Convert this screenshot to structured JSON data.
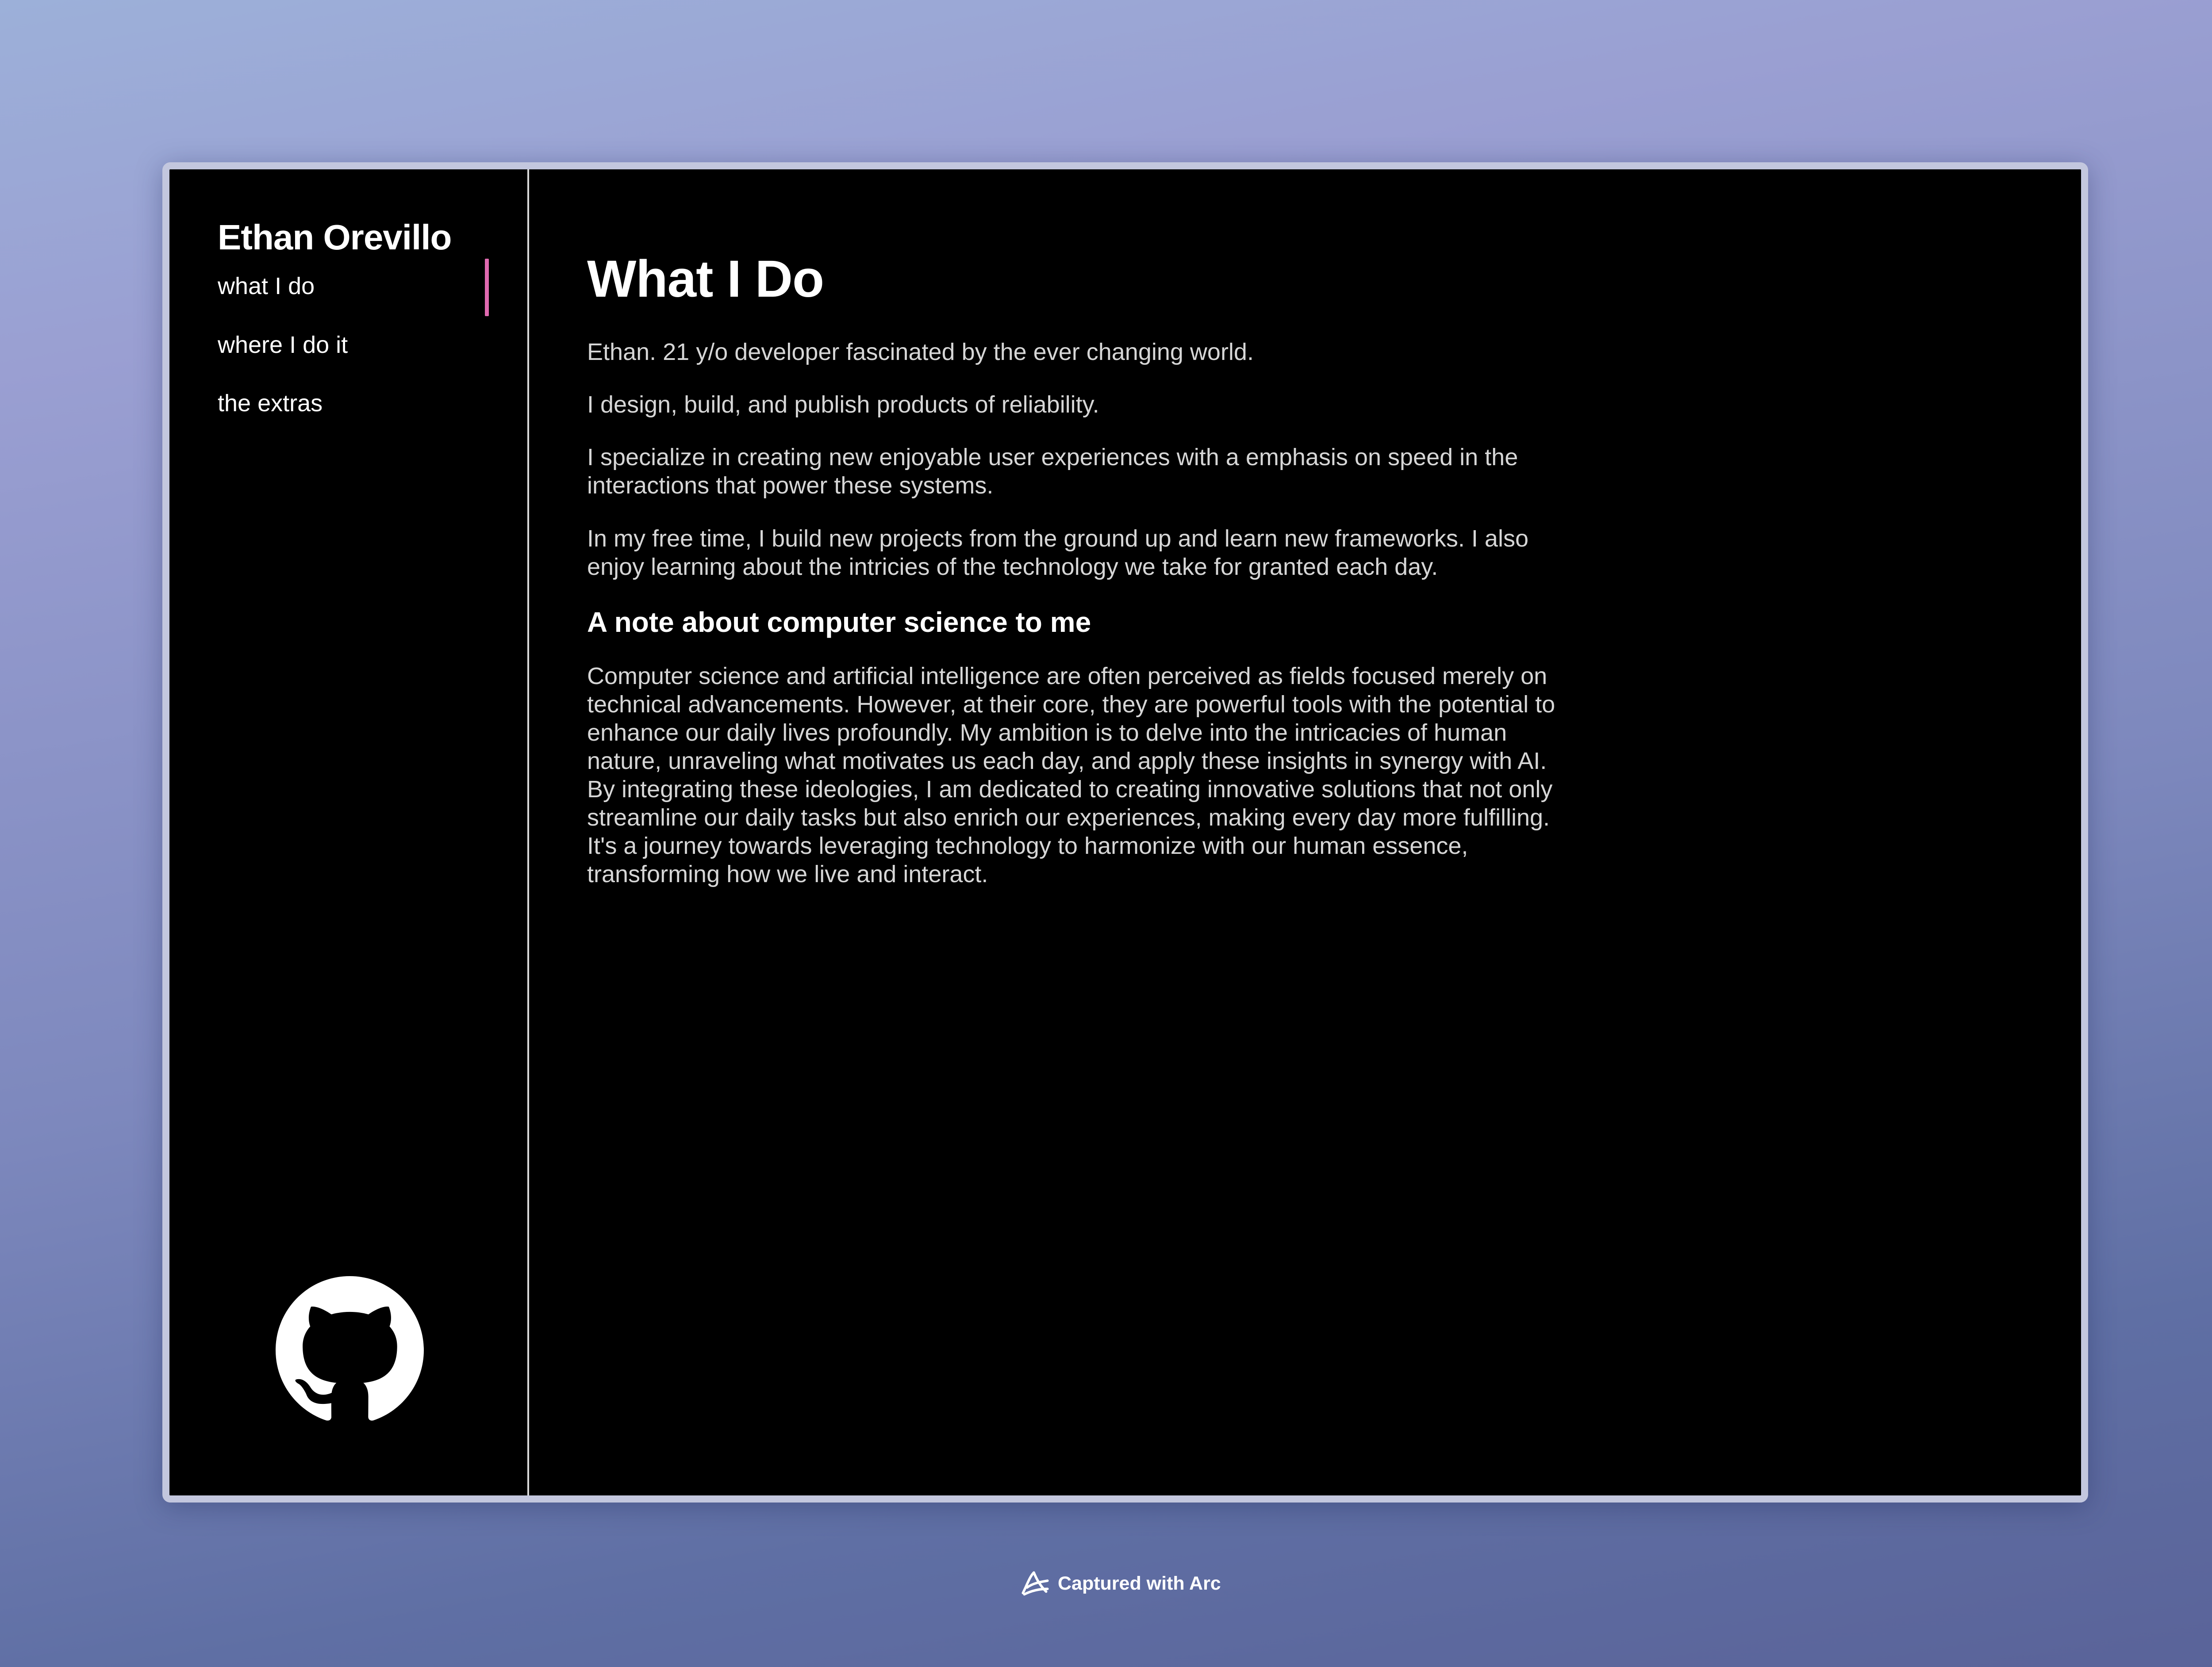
{
  "sidebar": {
    "name": "Ethan Orevillo",
    "nav": [
      {
        "label": "what I do",
        "active": true
      },
      {
        "label": "where I do it",
        "active": false
      },
      {
        "label": "the extras",
        "active": false
      }
    ],
    "social_icon": "github-icon"
  },
  "main": {
    "title": "What I Do",
    "paragraphs": [
      "Ethan. 21 y/o developer fascinated by the ever changing world.",
      "I design, build, and publish products of reliability.",
      "I specialize in creating new enjoyable user experiences with a emphasis on speed in the interactions that power these systems.",
      "In my free time, I build new projects from the ground up and learn new frameworks. I also enjoy learning about the intricies of the technology we take for granted each day."
    ],
    "subheading": "A note about computer science to me",
    "note": "Computer science and artificial intelligence are often perceived as fields focused merely on technical advancements. However, at their core, they are powerful tools with the potential to enhance our daily lives profoundly. My ambition is to delve into the intricacies of human nature, unraveling what motivates us each day, and apply these insights in synergy with AI. By integrating these ideologies, I am dedicated to creating innovative solutions that not only streamline our daily tasks but also enrich our experiences, making every day more fulfilling. It's a journey towards leveraging technology to harmonize with our human essence, transforming how we live and interact."
  },
  "footer": {
    "caption": "Captured with Arc",
    "icon": "arc-logo-icon"
  },
  "colors": {
    "accent": "#e06ab0",
    "background": "#000000",
    "text": "#ffffff",
    "body_text": "#d6d6d6",
    "frame": "#c3c7de"
  }
}
